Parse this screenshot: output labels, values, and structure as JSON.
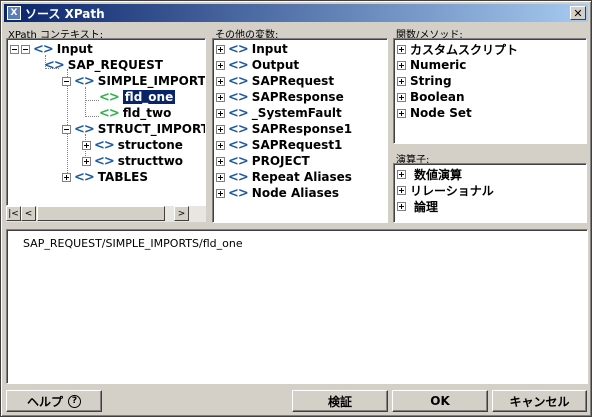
{
  "window": {
    "title": "ソース XPath",
    "close_label": "✕"
  },
  "xpath_context": {
    "label": "XPath コンテキスト:",
    "nodes": [
      {
        "label": "Input"
      },
      {
        "label": "SAP_REQUEST"
      },
      {
        "label": "SIMPLE_IMPORTS"
      },
      {
        "label": "fld_one",
        "selected": true
      },
      {
        "label": "fld_two"
      },
      {
        "label": "STRUCT_IMPORTS"
      },
      {
        "label": "structone"
      },
      {
        "label": "structtwo"
      },
      {
        "label": "TABLES"
      }
    ]
  },
  "other_vars": {
    "label": "その他の変数:",
    "items": [
      {
        "label": "Input"
      },
      {
        "label": "Output"
      },
      {
        "label": "SAPRequest"
      },
      {
        "label": "SAPResponse"
      },
      {
        "label": "_SystemFault"
      },
      {
        "label": "SAPResponse1"
      },
      {
        "label": "SAPRequest1"
      },
      {
        "label": "PROJECT"
      },
      {
        "label": "Repeat Aliases"
      },
      {
        "label": "Node Aliases"
      }
    ]
  },
  "functions": {
    "label": "関数/メソッド:",
    "items": [
      {
        "label": "カスタムスクリプト"
      },
      {
        "label": "Numeric"
      },
      {
        "label": "String"
      },
      {
        "label": "Boolean"
      },
      {
        "label": "Node Set"
      }
    ]
  },
  "operators": {
    "label": "演算子:",
    "items": [
      {
        "label": "数値演算"
      },
      {
        "label": "リレーショナル"
      },
      {
        "label": "論理"
      }
    ]
  },
  "expression": {
    "value": "SAP_REQUEST/SIMPLE_IMPORTS/fld_one"
  },
  "buttons": {
    "help": "ヘルプ",
    "help_icon": "?",
    "validate": "検証",
    "ok": "OK",
    "cancel": "キャンセル"
  },
  "icons": {
    "node": "<>",
    "scroll_left_end": "|<",
    "scroll_left": "<",
    "scroll_right": ">"
  },
  "colors": {
    "node_icon": "#1c5aa6",
    "leaf_icon": "#2db34a",
    "selection": "#0a246a"
  }
}
